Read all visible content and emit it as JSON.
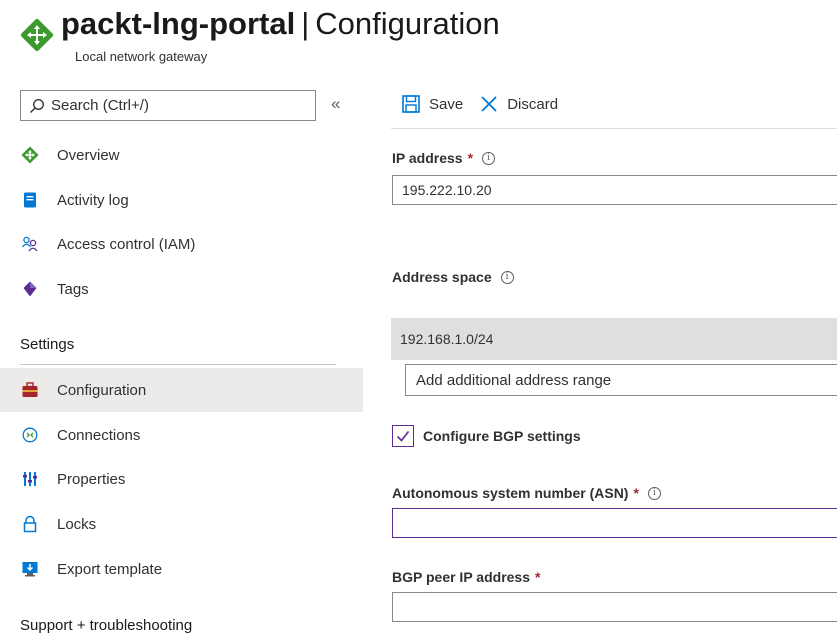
{
  "header": {
    "resource_name": "packt-lng-portal",
    "separator": "|",
    "blade_title": "Configuration",
    "resource_type": "Local network gateway",
    "icon": "local-network-gateway-icon",
    "icon_color": "#3c9a2f"
  },
  "sidebar": {
    "search_placeholder": "Search (Ctrl+/)",
    "collapse_glyph": "«",
    "items": [
      {
        "label": "Overview",
        "icon": "overview-icon"
      },
      {
        "label": "Activity log",
        "icon": "activity-log-icon"
      },
      {
        "label": "Access control (IAM)",
        "icon": "iam-icon"
      },
      {
        "label": "Tags",
        "icon": "tag-icon"
      }
    ],
    "settings_header": "Settings",
    "settings_items": [
      {
        "label": "Configuration",
        "icon": "configuration-icon",
        "active": true
      },
      {
        "label": "Connections",
        "icon": "connections-icon"
      },
      {
        "label": "Properties",
        "icon": "properties-icon"
      },
      {
        "label": "Locks",
        "icon": "lock-icon"
      },
      {
        "label": "Export template",
        "icon": "export-template-icon"
      }
    ],
    "support_header": "Support + troubleshooting"
  },
  "toolbar": {
    "save_label": "Save",
    "discard_label": "Discard"
  },
  "form": {
    "ip_address_label": "IP address",
    "ip_address_value": "195.222.10.20",
    "required_marker": "*",
    "info_glyph": "i",
    "address_space_label": "Address space",
    "address_ranges": [
      "192.168.1.0/24"
    ],
    "add_range_placeholder": "Add additional address range",
    "bgp_checkbox_label": "Configure BGP settings",
    "bgp_checked": true,
    "asn_label": "Autonomous system number (ASN)",
    "asn_value": "",
    "bgp_peer_label": "BGP peer IP address",
    "bgp_peer_value": ""
  },
  "colors": {
    "accent": "#0078d4",
    "required": "#a4262c",
    "focus_border": "#5c2d91",
    "active_nav_bg": "#edebe9",
    "range_row_bg": "#e1dfdd"
  }
}
